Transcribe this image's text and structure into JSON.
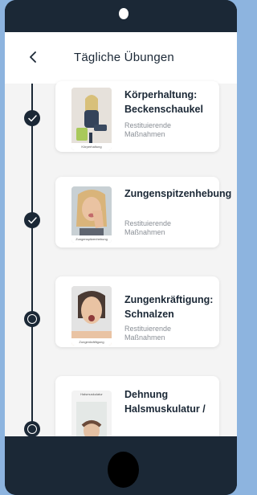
{
  "header": {
    "title": "Tägliche Übungen",
    "back_icon": "chevron-left-icon"
  },
  "exercises": [
    {
      "title": "Körperhaltung: Beckenschaukel",
      "subtitle": "Restituierende Maßnahmen",
      "thumb_caption": "Körperhaltung",
      "status": "completed"
    },
    {
      "title": "Zungenspitzenhebung",
      "subtitle": "Restituierende Maßnahmen",
      "thumb_caption": "Zungenspitzenhebung",
      "status": "completed"
    },
    {
      "title": "Zungenkräftigung: Schnalzen",
      "subtitle": "Restituierende Maßnahmen",
      "thumb_caption": "Zungenkräftigung",
      "status": "open"
    },
    {
      "title": "Dehnung Halsmuskulatur /",
      "subtitle": "",
      "thumb_caption": "Halsmuskulatur",
      "status": "open"
    }
  ],
  "colors": {
    "primary": "#1b2836",
    "background": "#f4f4f4",
    "frame": "#8db4df",
    "subtitle": "#8a8f96"
  }
}
